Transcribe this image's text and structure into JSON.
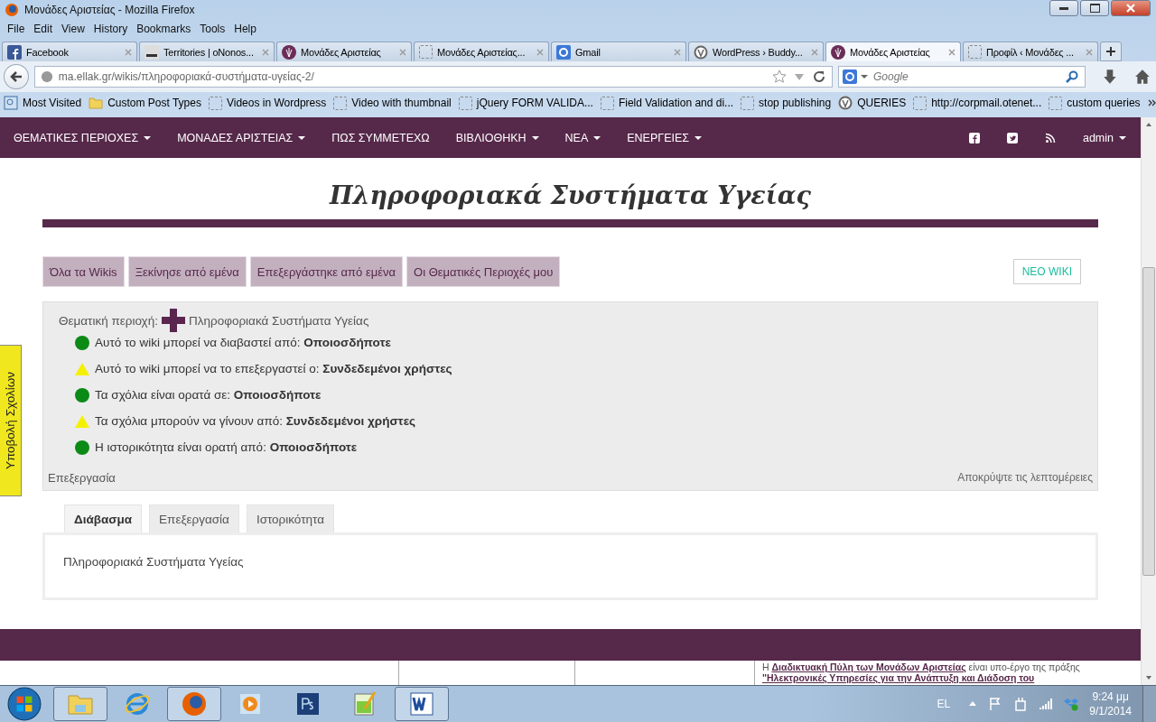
{
  "window": {
    "title": "Μονάδες Αριστείας - Mozilla Firefox"
  },
  "menu": [
    "File",
    "Edit",
    "View",
    "History",
    "Bookmarks",
    "Tools",
    "Help"
  ],
  "tabs": [
    {
      "label": "Facebook",
      "kind": "facebook",
      "selected": false
    },
    {
      "label": "Territories | oNonos...",
      "kind": "image",
      "selected": false
    },
    {
      "label": "Μονάδες Αριστείας",
      "kind": "site",
      "selected": false
    },
    {
      "label": "Μονάδες Αριστείας...",
      "kind": "blank",
      "selected": false
    },
    {
      "label": "Gmail",
      "kind": "google",
      "selected": false
    },
    {
      "label": "WordPress › Buddy...",
      "kind": "wordpress",
      "selected": false
    },
    {
      "label": "Μονάδες Αριστείας",
      "kind": "site",
      "selected": true
    },
    {
      "label": "Προφίλ ‹ Μονάδες ...",
      "kind": "blank",
      "selected": false
    }
  ],
  "address": {
    "url": "ma.ellak.gr/wikis/πληροφοριακά-συστήματα-υγείας-2/"
  },
  "search": {
    "placeholder": "Google"
  },
  "bookmarks": [
    {
      "label": "Most Visited",
      "kind": "page"
    },
    {
      "label": "Custom Post Types",
      "kind": "folder"
    },
    {
      "label": "Videos in Wordpress",
      "kind": "blank"
    },
    {
      "label": "Video with thumbnail",
      "kind": "blank"
    },
    {
      "label": "jQuery FORM VALIDA...",
      "kind": "blank"
    },
    {
      "label": "Field Validation and di...",
      "kind": "blank"
    },
    {
      "label": "stop publishing",
      "kind": "blank"
    },
    {
      "label": "QUERIES",
      "kind": "wordpress"
    },
    {
      "label": "http://corpmail.otenet...",
      "kind": "blank"
    },
    {
      "label": "custom queries",
      "kind": "blank"
    }
  ],
  "nav": {
    "items": [
      {
        "label": "ΘΕΜΑΤΙΚΕΣ ΠΕΡΙΟΧΕΣ",
        "dropdown": true
      },
      {
        "label": "ΜΟΝΑΔΕΣ ΑΡΙΣΤΕΙΑΣ",
        "dropdown": true
      },
      {
        "label": "ΠΩΣ ΣΥΜΜΕΤΕΧΩ",
        "dropdown": false
      },
      {
        "label": "ΒΙΒΛΙΟΘΗΚΗ",
        "dropdown": true
      },
      {
        "label": "ΝΕΑ",
        "dropdown": true
      },
      {
        "label": "ΕΝΕΡΓΕΙΕΣ",
        "dropdown": true
      }
    ],
    "user": "admin"
  },
  "page_title": "Πληροφοριακά Συστήματα Υγείας",
  "wiki_tabs": [
    "Όλα τα Wikis",
    "Ξεκίνησε από εμένα",
    "Επεξεργάστηκε από εμένα",
    "Οι Θεματικές Περιοχές μου"
  ],
  "new_wiki_button": "ΝΕΟ WIKI",
  "details": {
    "topic_label": "Θεματική περιοχή:",
    "topic": "Πληροφοριακά Συστήματα Υγείας",
    "permissions": [
      {
        "text": "Αυτό το wiki μπορεί να διαβαστεί από: **Οποιοσδήποτε**",
        "kind": "ok"
      },
      {
        "text": "Αυτό το wiki μπορεί να το επεξεργαστεί ο: **Συνδεδεμένοι χρήστες**",
        "kind": "warn"
      },
      {
        "text": "Τα σχόλια είναι ορατά σε: **Οποιοσδήποτε**",
        "kind": "ok"
      },
      {
        "text": "Τα σχόλια μπορούν να γίνουν από: **Συνδεδεμένοι χρήστες**",
        "kind": "warn"
      },
      {
        "text": "Η ιστορικότητα είναι ορατή από: **Οποιοσδήποτε**",
        "kind": "ok"
      }
    ],
    "edit_link": "Επεξεργασία",
    "hide_link": "Αποκρύψτε τις λεπτομέρειες"
  },
  "content_tabs": [
    {
      "label": "Διάβασμα",
      "selected": true
    },
    {
      "label": "Επεξεργασία",
      "selected": false
    },
    {
      "label": "Ιστορικότητα",
      "selected": false
    }
  ],
  "content_text": "Πληροφοριακά Συστήματα Υγείας",
  "side_tab": "Υποβολή Σχολίων",
  "footer_text": "Η **Διαδικτυακή Πύλη των Μονάδων Αριστείας** είναι υπο-έργο της πράξης **\"Ηλεκτρονικές Υπηρεσίες για την Ανάπτυξη και Διάδοση του**",
  "taskbar": {
    "apps": [
      {
        "kind": "explorer",
        "active": true
      },
      {
        "kind": "ie",
        "active": false
      },
      {
        "kind": "firefox",
        "active": true
      },
      {
        "kind": "media",
        "active": false
      },
      {
        "kind": "photoshop",
        "active": false
      },
      {
        "kind": "notepad",
        "active": false
      },
      {
        "kind": "word",
        "active": true
      }
    ],
    "language": "EL",
    "time": "9:24 μμ",
    "date": "9/1/2014"
  }
}
